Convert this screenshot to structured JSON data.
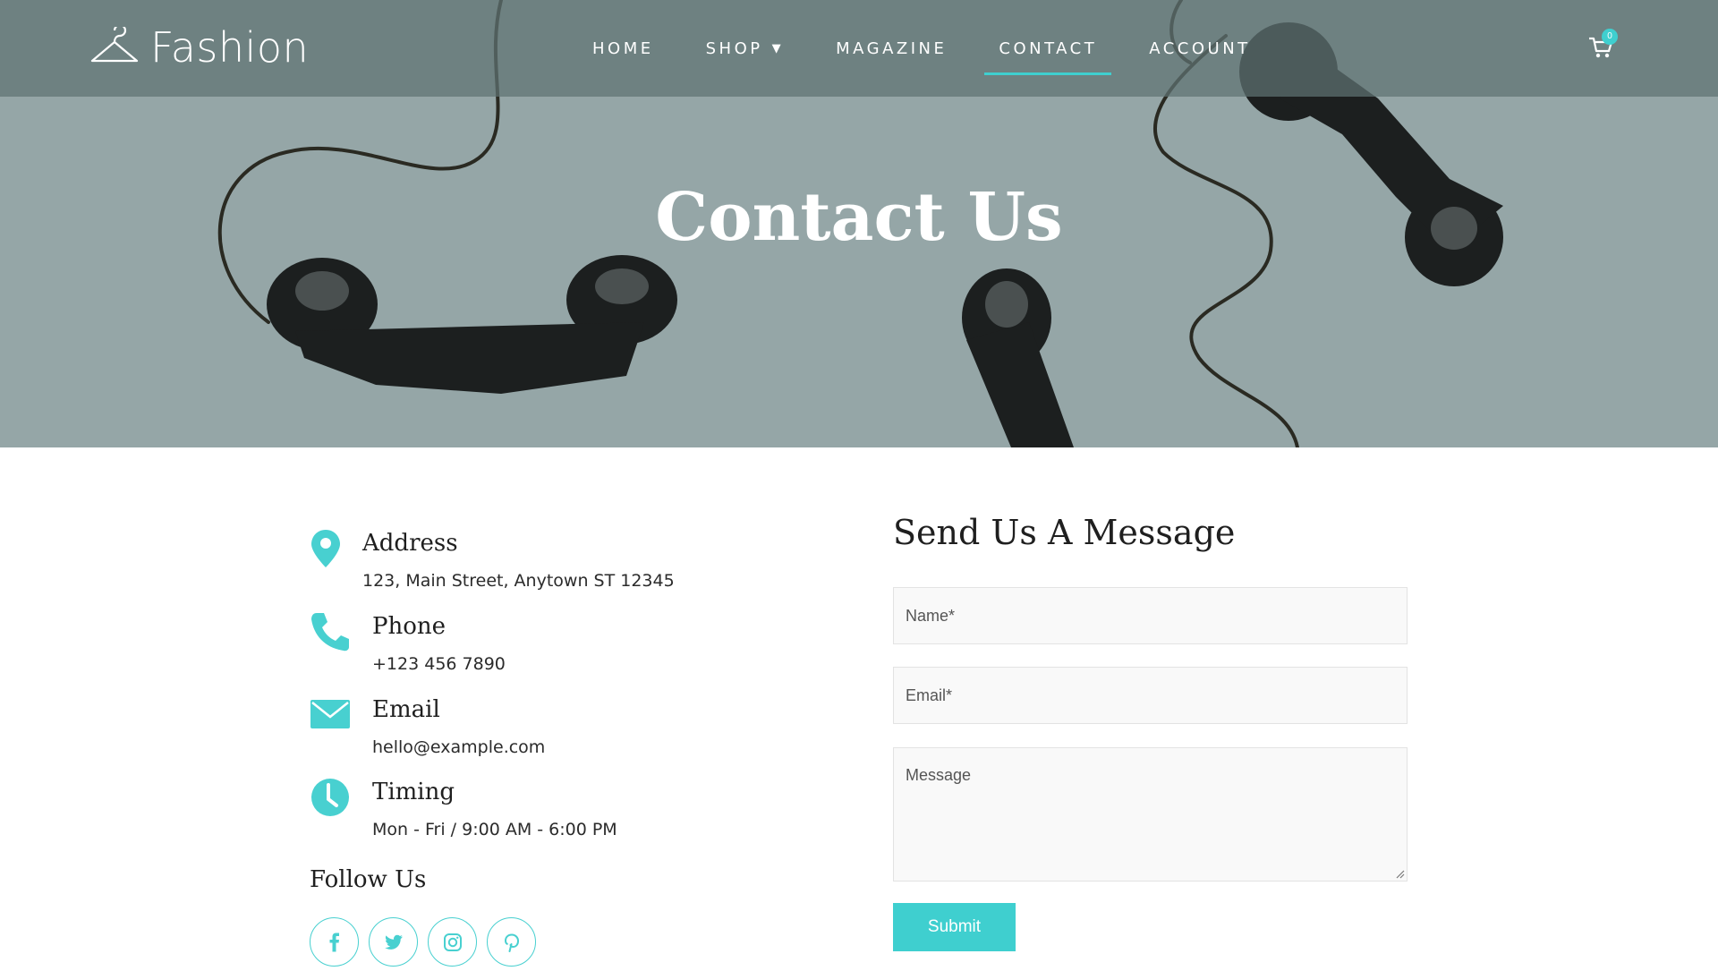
{
  "header": {
    "logo_text": "Fashion",
    "nav": [
      {
        "label": "HOME"
      },
      {
        "label": "SHOP"
      },
      {
        "label": "MAGAZINE"
      },
      {
        "label": "CONTACT"
      },
      {
        "label": "ACCOUNT"
      }
    ],
    "active_nav": "CONTACT",
    "cart_count": "0"
  },
  "hero": {
    "title": "Contact Us"
  },
  "contact_info": {
    "address": {
      "title": "Address",
      "value": "123, Main Street, Anytown ST 12345",
      "icon": "map-pin-icon"
    },
    "phone": {
      "title": "Phone",
      "value": "+123 456 7890",
      "icon": "phone-icon"
    },
    "email": {
      "title": "Email",
      "value": "hello@example.com",
      "icon": "envelope-icon"
    },
    "timing": {
      "title": "Timing",
      "value": "Mon - Fri / 9:00 AM - 6:00 PM",
      "icon": "clock-icon"
    }
  },
  "follow": {
    "title": "Follow Us",
    "networks": [
      "facebook-icon",
      "twitter-icon",
      "instagram-icon",
      "pinterest-icon"
    ]
  },
  "form": {
    "title": "Send Us A Message",
    "name_placeholder": "Name*",
    "email_placeholder": "Email*",
    "message_placeholder": "Message",
    "submit_label": "Submit"
  },
  "colors": {
    "accent": "#3fcfcf",
    "hero_bg": "#95a6a7",
    "topbar": "#5f7373"
  }
}
